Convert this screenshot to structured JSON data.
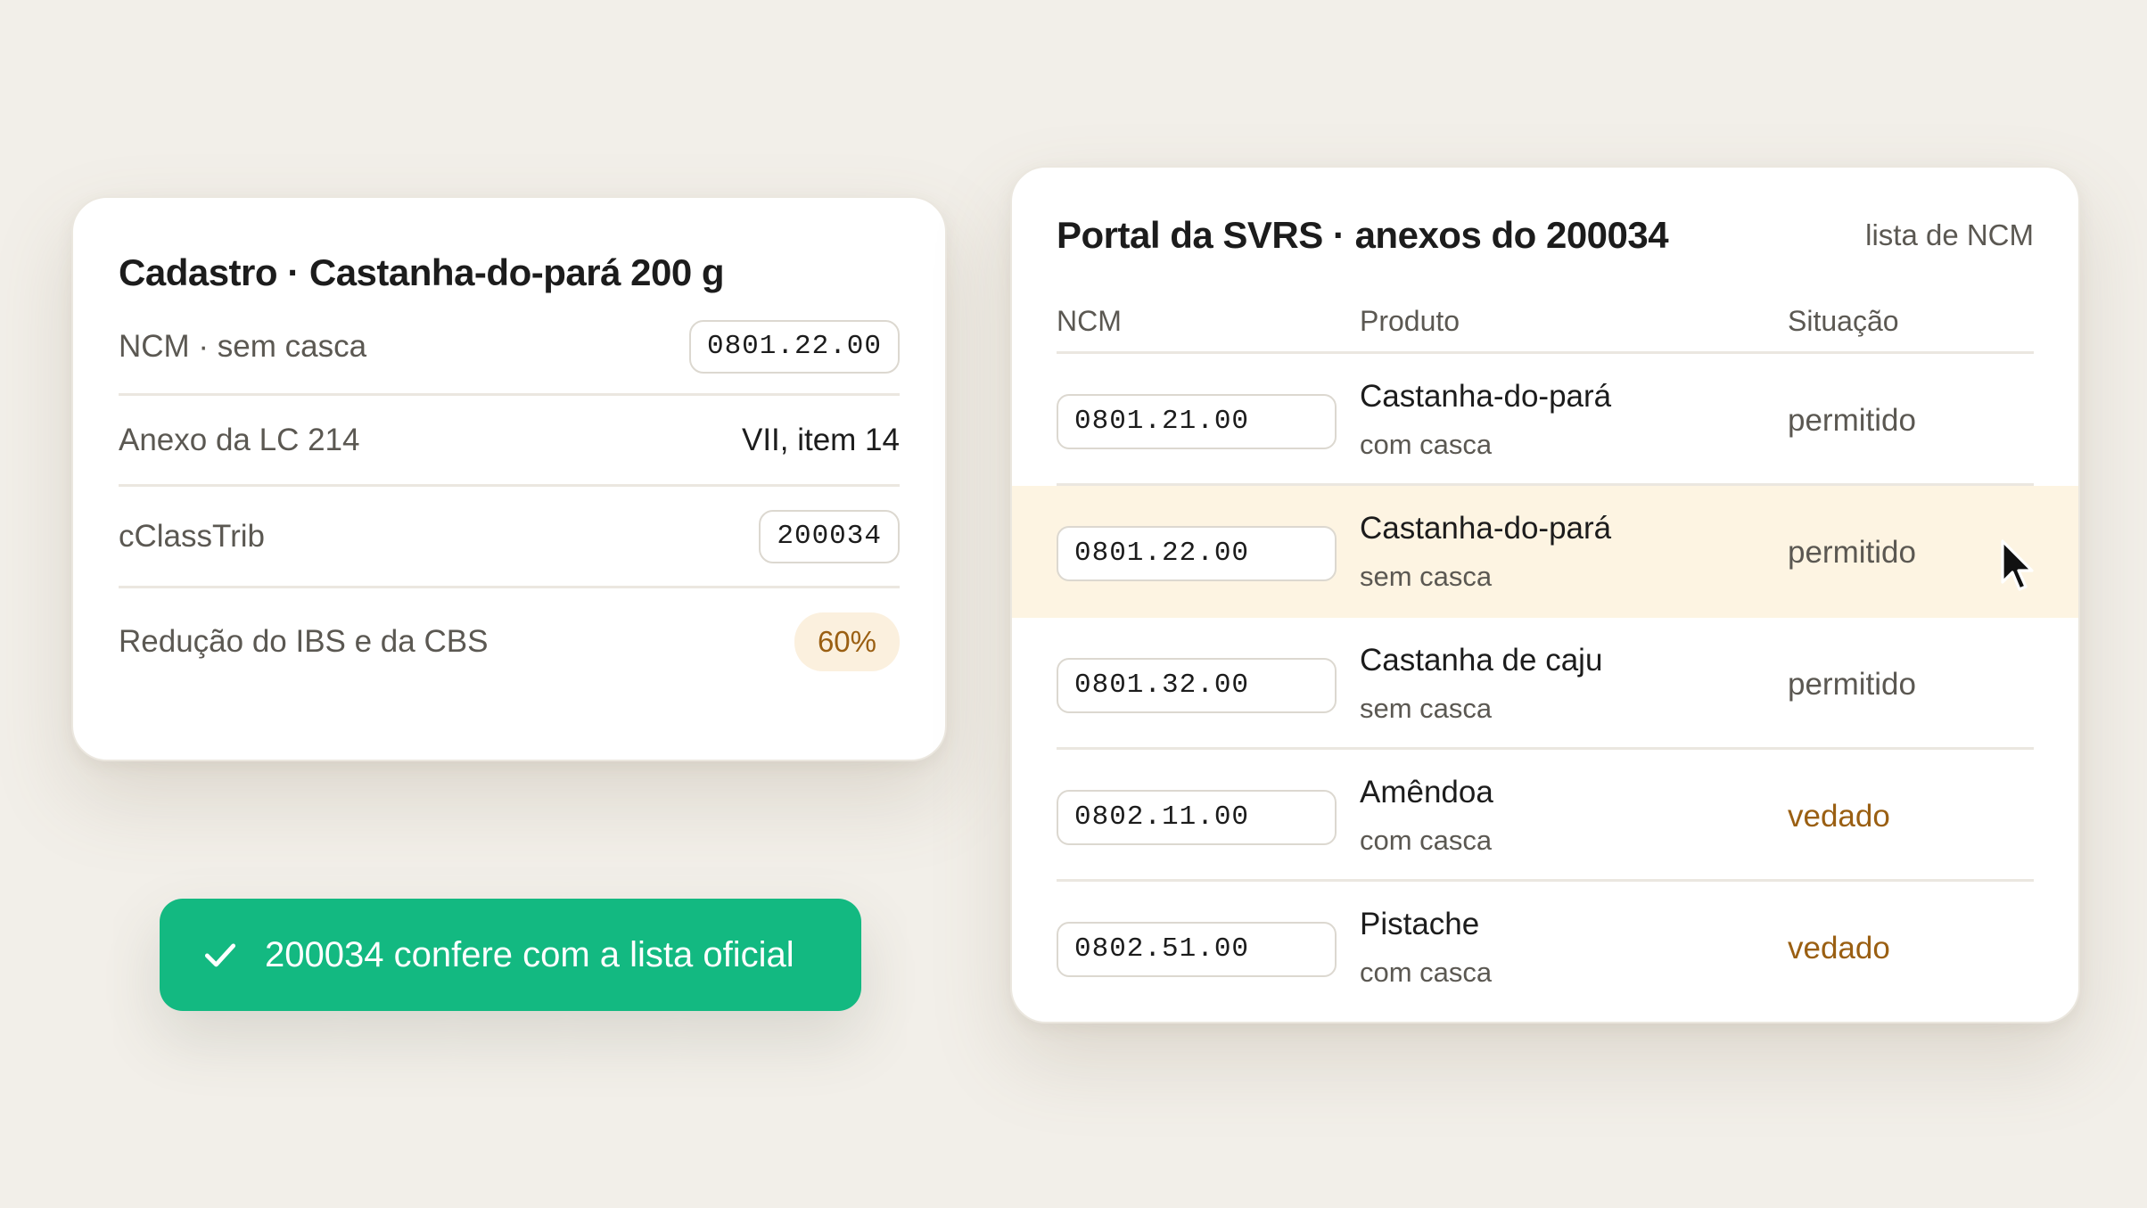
{
  "cadastro": {
    "title": "Cadastro · Castanha-do-pará 200 g",
    "fields": [
      {
        "label": "NCM · sem casca",
        "value": "0801.22.00"
      },
      {
        "label": "Anexo da LC 214",
        "value": "VII, item 14"
      },
      {
        "label": "cClassTrib",
        "value": "200034"
      },
      {
        "label": "Redução do IBS e da CBS",
        "value": "60%"
      }
    ]
  },
  "confirm": {
    "label": "200034 confere com a lista oficial",
    "icon": "check-icon",
    "color": "#13b981"
  },
  "portal": {
    "title": "Portal da SVRS · anexos do 200034",
    "tag": "lista de NCM",
    "columns": [
      "NCM",
      "Produto",
      "Situação"
    ],
    "rows": [
      {
        "ncm": "0801.21.00",
        "product": "Castanha-do-pará",
        "detail": "com casca",
        "status": "permitido"
      },
      {
        "ncm": "0801.22.00",
        "product": "Castanha-do-pará",
        "detail": "sem casca",
        "status": "permitido"
      },
      {
        "ncm": "0801.32.00",
        "product": "Castanha de caju",
        "detail": "sem casca",
        "status": "permitido"
      },
      {
        "ncm": "0802.11.00",
        "product": "Amêndoa",
        "detail": "com casca",
        "status": "vedado"
      },
      {
        "ncm": "0802.51.00",
        "product": "Pistache",
        "detail": "com casca",
        "status": "vedado"
      }
    ],
    "highlight_color": "#fdf4e2",
    "status_colors": {
      "permitido": "#5b5852",
      "vedado": "#9a5f12"
    }
  },
  "cursor_icon": "mouse-pointer-icon"
}
